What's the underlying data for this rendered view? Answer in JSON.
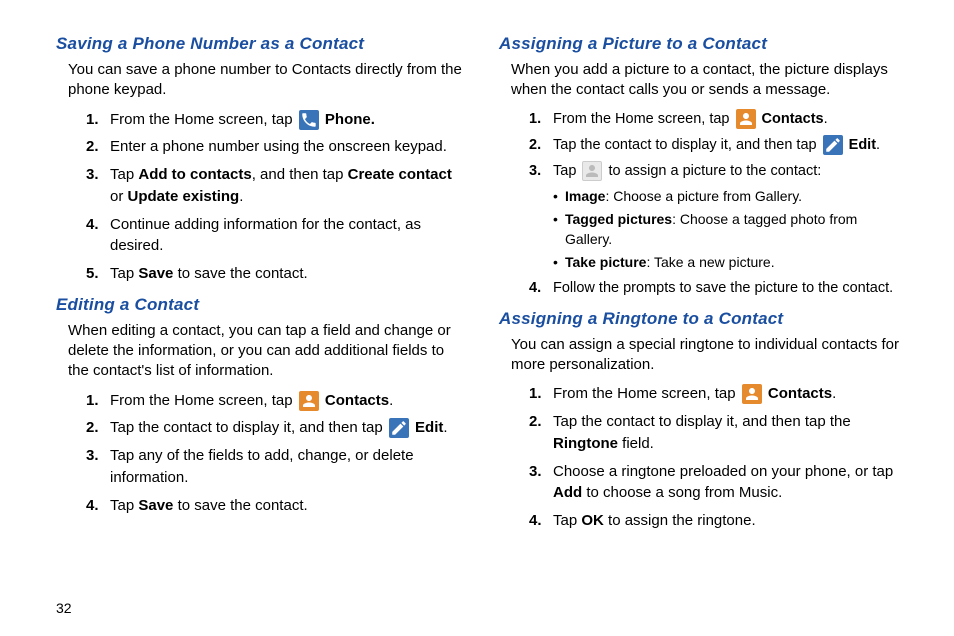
{
  "pageNumber": "32",
  "left": {
    "sec1": {
      "title": "Saving a Phone Number as a Contact",
      "intro": "You can save a phone number to Contacts directly from the phone keypad.",
      "step1": {
        "a": "From the Home screen, tap ",
        "b": "Phone."
      },
      "step2": "Enter a phone number using the onscreen keypad.",
      "step3": {
        "a": "Tap ",
        "b": "Add to contacts",
        "c": ", and then tap ",
        "d": "Create contact",
        "e": " or ",
        "f": "Update existing",
        "g": "."
      },
      "step4": "Continue adding information for the contact, as desired.",
      "step5": {
        "a": "Tap ",
        "b": "Save",
        "c": " to save the contact."
      }
    },
    "sec2": {
      "title": "Editing a Contact",
      "intro": "When editing a contact, you can tap a field and change or delete the information, or you can add additional fields to the contact's list of information.",
      "step1": {
        "a": "From the Home screen, tap ",
        "b": "Contacts",
        "c": "."
      },
      "step2": {
        "a": "Tap the contact to display it, and then tap ",
        "b": "Edit",
        "c": "."
      },
      "step3": "Tap any of the fields to add, change, or delete information.",
      "step4": {
        "a": "Tap ",
        "b": "Save",
        "c": " to save the contact."
      }
    }
  },
  "right": {
    "sec1": {
      "title": "Assigning a Picture to a Contact",
      "intro": "When you add a picture to a contact, the picture displays when the contact calls you or sends a message.",
      "step1": {
        "a": "From the Home screen, tap ",
        "b": "Contacts",
        "c": "."
      },
      "step2": {
        "a": "Tap the contact to display it, and then tap ",
        "b": "Edit",
        "c": "."
      },
      "step3": {
        "a": "Tap ",
        "b": " to assign a picture to the contact:"
      },
      "sub": {
        "a1": "Image",
        "a2": ": Choose a picture from Gallery.",
        "b1": "Tagged pictures",
        "b2": ": Choose a tagged photo from Gallery.",
        "c1": "Take picture",
        "c2": ": Take a new picture."
      },
      "step4": "Follow the prompts to save the picture to the contact."
    },
    "sec2": {
      "title": "Assigning a Ringtone to a Contact",
      "intro": "You can assign a special ringtone to individual contacts for more personalization.",
      "step1": {
        "a": "From the Home screen, tap ",
        "b": "Contacts",
        "c": "."
      },
      "step2": {
        "a": "Tap the contact to display it, and then tap the ",
        "b": "Ringtone",
        "c": " field."
      },
      "step3": {
        "a": "Choose a ringtone preloaded on your phone, or tap ",
        "b": "Add",
        "c": " to choose a song from Music."
      },
      "step4": {
        "a": "Tap ",
        "b": "OK",
        "c": " to assign the ringtone."
      }
    }
  }
}
